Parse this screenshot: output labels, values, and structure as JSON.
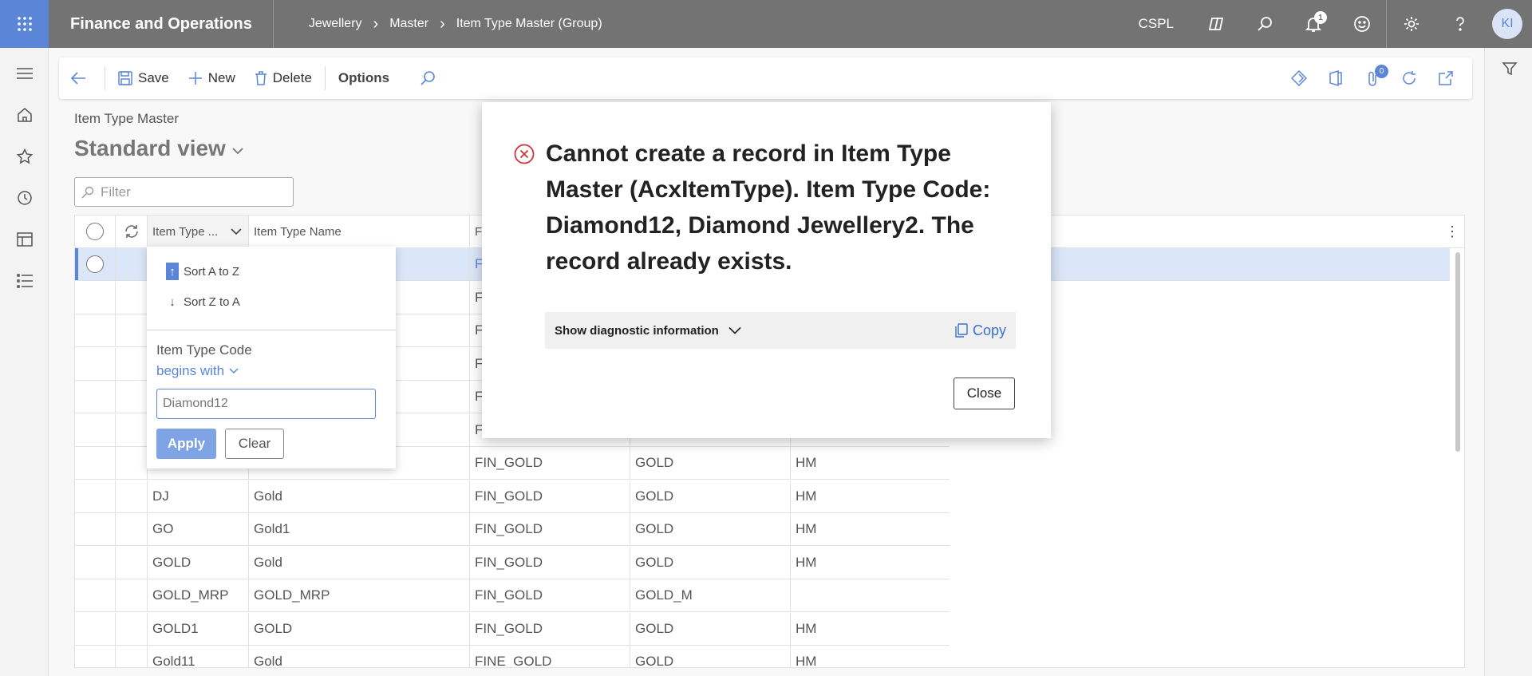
{
  "topbar": {
    "app_title": "Finance and Operations",
    "breadcrumb": [
      "Jewellery",
      "Master",
      "Item Type Master (Group)"
    ],
    "company": "CSPL",
    "notification_count": "1",
    "avatar_initials": "KI"
  },
  "actions": {
    "save": "Save",
    "new": "New",
    "delete": "Delete",
    "options": "Options",
    "attachments_count": "0"
  },
  "page": {
    "subtitle": "Item Type Master",
    "view": "Standard view",
    "filter_placeholder": "Filter"
  },
  "grid": {
    "columns": [
      "Item Type ...",
      "Item Type Name",
      "Fi"
    ],
    "rows": [
      {
        "code": "",
        "name": "",
        "fin": "FI",
        "metal": "",
        "hm": ""
      },
      {
        "code": "",
        "name": "",
        "fin": "FI",
        "metal": "",
        "hm": ""
      },
      {
        "code": "",
        "name": "",
        "fin": "FI",
        "metal": "",
        "hm": ""
      },
      {
        "code": "",
        "name": "",
        "fin": "FI",
        "metal": "",
        "hm": ""
      },
      {
        "code": "",
        "name": "",
        "fin": "FI",
        "metal": "",
        "hm": ""
      },
      {
        "code": "",
        "name": "",
        "fin": "FI",
        "metal": "",
        "hm": ""
      },
      {
        "code": "",
        "name": "",
        "fin": "FIN_GOLD",
        "metal": "GOLD",
        "hm": "HM"
      },
      {
        "code": "DJ",
        "name": "Gold",
        "fin": "FIN_GOLD",
        "metal": "GOLD",
        "hm": "HM"
      },
      {
        "code": "GO",
        "name": "Gold1",
        "fin": "FIN_GOLD",
        "metal": "GOLD",
        "hm": "HM"
      },
      {
        "code": "GOLD",
        "name": "Gold",
        "fin": "FIN_GOLD",
        "metal": "GOLD",
        "hm": "HM"
      },
      {
        "code": "GOLD_MRP",
        "name": "GOLD_MRP",
        "fin": "FIN_GOLD",
        "metal": "GOLD_M",
        "hm": ""
      },
      {
        "code": "GOLD1",
        "name": "GOLD",
        "fin": "FIN_GOLD",
        "metal": "GOLD",
        "hm": "HM"
      },
      {
        "code": "Gold11",
        "name": "Gold",
        "fin": "FINE_GOLD",
        "metal": "GOLD",
        "hm": "HM"
      }
    ]
  },
  "column_menu": {
    "sort_asc": "Sort A to Z",
    "sort_desc": "Sort Z to A",
    "field_label": "Item Type Code",
    "operator": "begins with",
    "value": "Diamond12",
    "apply": "Apply",
    "clear": "Clear"
  },
  "dialog": {
    "message": "Cannot create a record in Item Type Master (AcxItemType). Item Type Code: Diamond12, Diamond Jewellery2. The record already exists.",
    "diagnostic": "Show diagnostic information",
    "copy": "Copy",
    "close": "Close"
  },
  "colors": {
    "topbar": "#737373",
    "accent": "#5b86d8",
    "error": "#d13438"
  }
}
